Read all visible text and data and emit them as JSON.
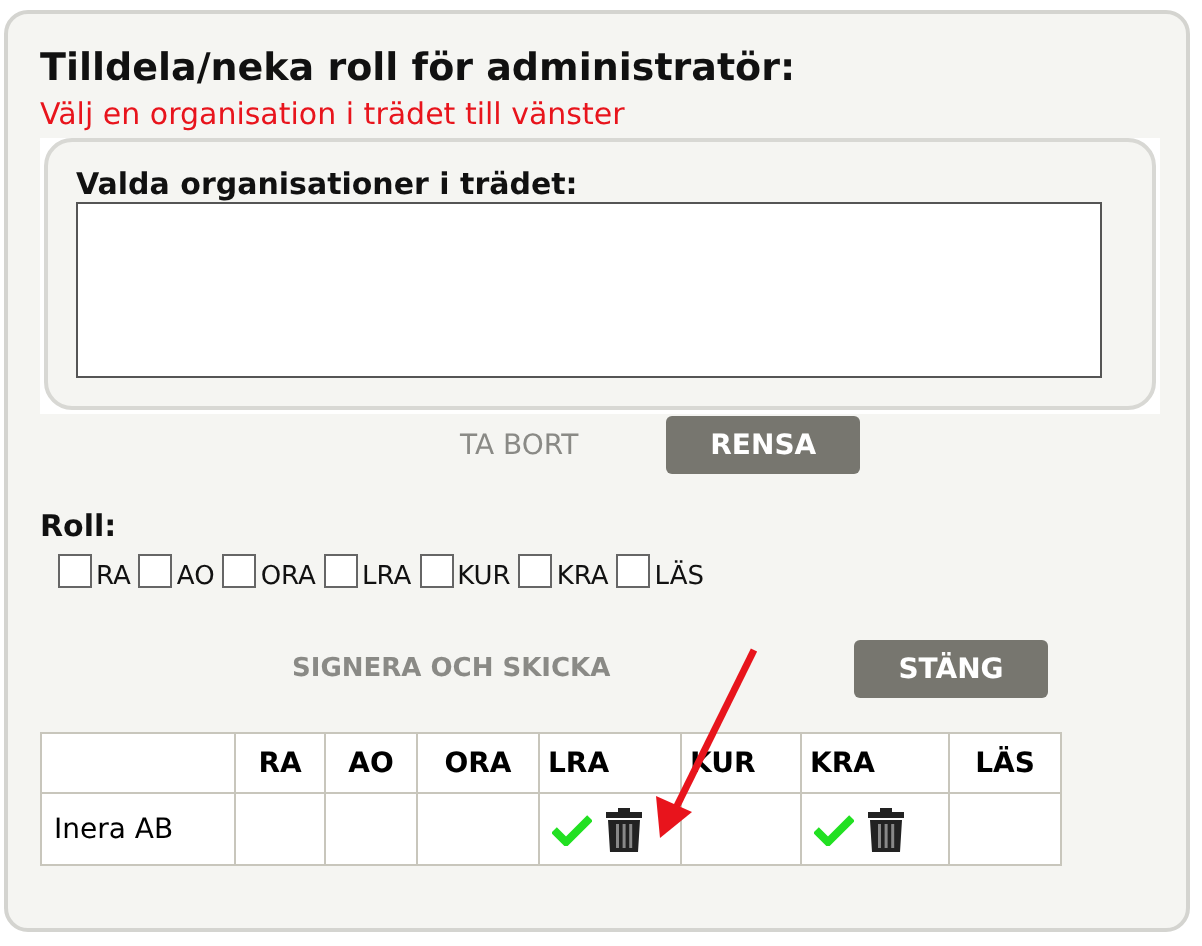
{
  "title": "Tilldela/neka roll för administratör:",
  "hint": "Välj en organisation i trädet till vänster",
  "selection": {
    "label": "Valda organisationer i trädet:"
  },
  "selection_buttons": [
    {
      "label": "TA BORT",
      "disabled": true
    },
    {
      "label": "RENSA",
      "disabled": false
    }
  ],
  "roles": {
    "label": "Roll:",
    "options": [
      {
        "label": "RA",
        "checked": false
      },
      {
        "label": "AO",
        "checked": false
      },
      {
        "label": "ORA",
        "checked": false
      },
      {
        "label": "LRA",
        "checked": false
      },
      {
        "label": "KUR",
        "checked": false
      },
      {
        "label": "KRA",
        "checked": false
      },
      {
        "label": "LÄS",
        "checked": false
      }
    ]
  },
  "actions": [
    {
      "label": "SIGNERA OCH SKICKA",
      "disabled": true
    },
    {
      "label": "STÄNG",
      "disabled": false
    }
  ],
  "table": {
    "columns": [
      "RA",
      "AO",
      "ORA",
      "LRA",
      "KUR",
      "KRA",
      "LÄS"
    ],
    "rows": [
      {
        "name": "Inera AB",
        "cells": [
          {
            "assigned": false
          },
          {
            "assigned": false
          },
          {
            "assigned": false
          },
          {
            "assigned": true
          },
          {
            "assigned": false
          },
          {
            "assigned": true
          },
          {
            "assigned": false
          }
        ]
      }
    ]
  }
}
